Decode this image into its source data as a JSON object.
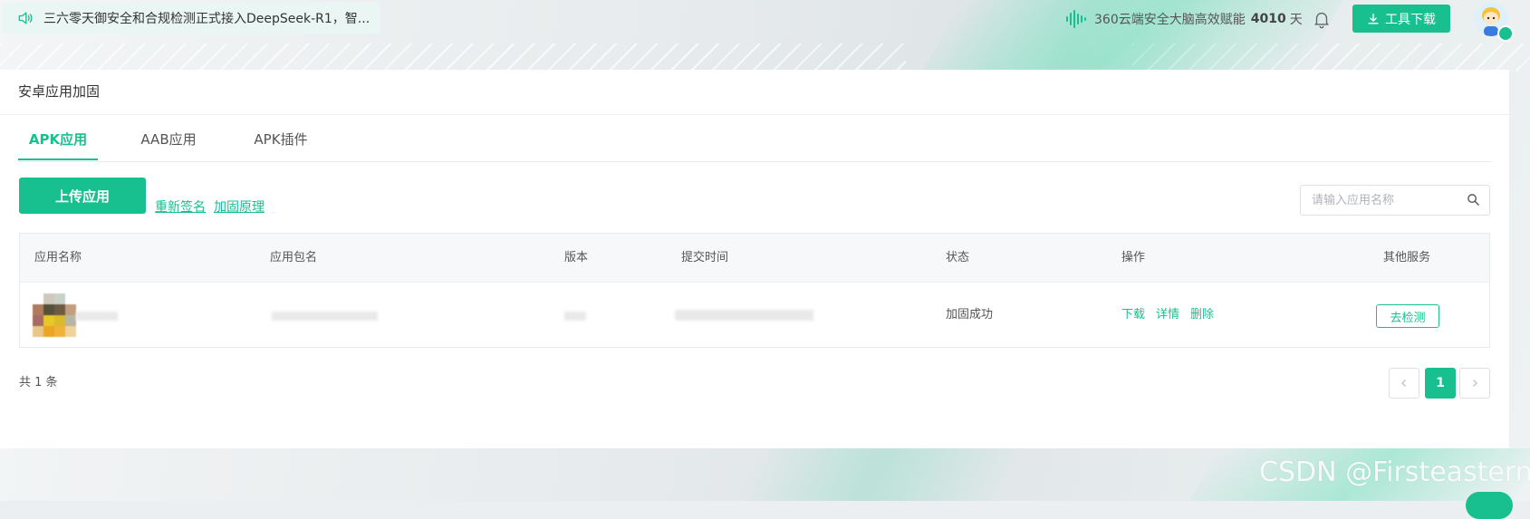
{
  "notice": {
    "text": "三六零天御安全和合规检测正式接入DeepSeek-R1，智..."
  },
  "header": {
    "brain_text": "360云端安全大脑高效赋能",
    "brain_days": "4010",
    "brain_unit": "天",
    "download_label": "工具下载"
  },
  "page": {
    "title": "安卓应用加固"
  },
  "tabs": [
    {
      "label": "APK应用",
      "active": true
    },
    {
      "label": "AAB应用",
      "active": false
    },
    {
      "label": "APK插件",
      "active": false
    }
  ],
  "toolbar": {
    "upload_label": "上传应用",
    "resign_link": "重新签名",
    "principle_link": "加固原理",
    "search_placeholder": "请输入应用名称"
  },
  "table": {
    "columns": [
      "应用名称",
      "应用包名",
      "版本",
      "提交时间",
      "状态",
      "操作",
      "其他服务"
    ],
    "rows": [
      {
        "status": "加固成功",
        "actions": [
          "下载",
          "详情",
          "删除"
        ],
        "service": "去检测"
      }
    ]
  },
  "pagination": {
    "total_text": "共 1 条",
    "current_page": "1"
  },
  "watermark": "CSDN @Firsteastern",
  "colors": {
    "accent": "#18c08f"
  }
}
